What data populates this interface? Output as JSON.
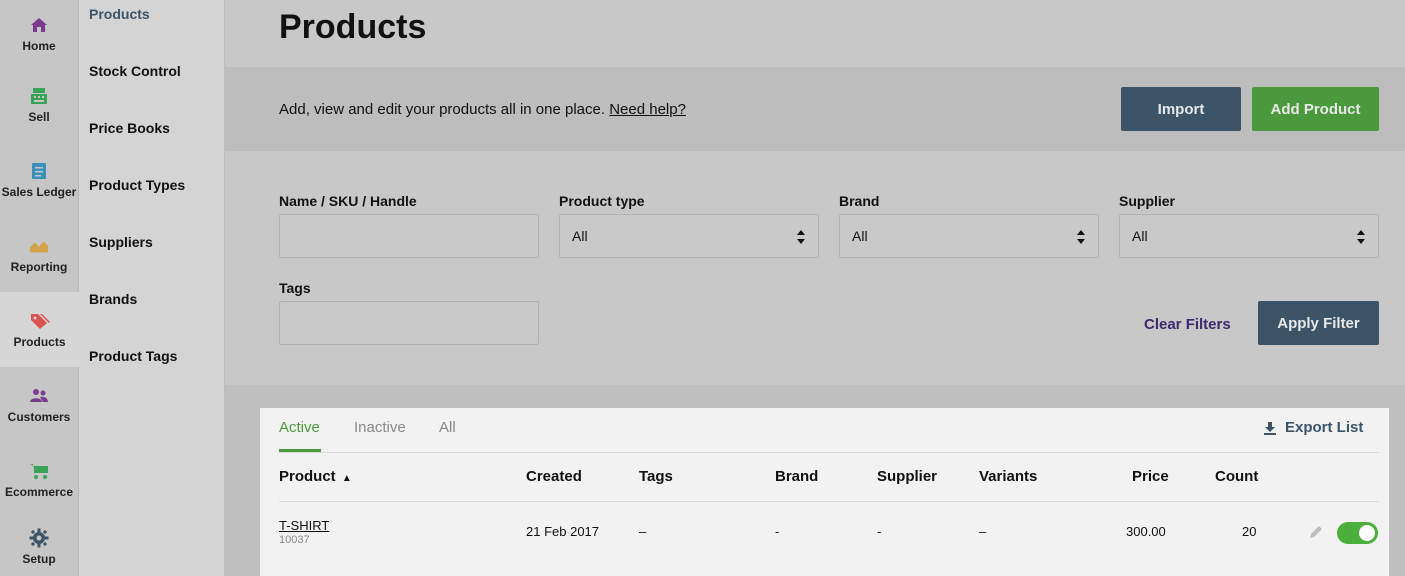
{
  "nav": {
    "items": [
      {
        "label": "Home",
        "icon": "home-icon",
        "color": "#7a3b8f"
      },
      {
        "label": "Sell",
        "icon": "register-icon",
        "color": "#3aa35a"
      },
      {
        "label": "Sales Ledger",
        "icon": "ledger-icon",
        "color": "#3a90b8"
      },
      {
        "label": "Reporting",
        "icon": "chart-icon",
        "color": "#d4a24a"
      },
      {
        "label": "Products",
        "icon": "tag-icon",
        "color": "#d9534f"
      },
      {
        "label": "Customers",
        "icon": "people-icon",
        "color": "#7a3b8f"
      },
      {
        "label": "Ecommerce",
        "icon": "cart-icon",
        "color": "#3aa35a"
      },
      {
        "label": "Setup",
        "icon": "gear-icon",
        "color": "#3b5468"
      }
    ]
  },
  "submenu": {
    "items": [
      "Products",
      "Stock Control",
      "Price Books",
      "Product Types",
      "Suppliers",
      "Brands",
      "Product Tags"
    ]
  },
  "page": {
    "title": "Products",
    "intro": "Add, view and edit your products all in one place.",
    "help_link": "Need help?",
    "import_label": "Import",
    "add_label": "Add Product"
  },
  "filters": {
    "name_label": "Name / SKU / Handle",
    "name_value": "",
    "type_label": "Product type",
    "type_value": "All",
    "brand_label": "Brand",
    "brand_value": "All",
    "supplier_label": "Supplier",
    "supplier_value": "All",
    "tags_label": "Tags",
    "tags_value": "",
    "clear_label": "Clear Filters",
    "apply_label": "Apply Filter"
  },
  "list": {
    "tabs": [
      "Active",
      "Inactive",
      "All"
    ],
    "export_label": "Export List",
    "columns": [
      "Product",
      "Created",
      "Tags",
      "Brand",
      "Supplier",
      "Variants",
      "Price",
      "Count"
    ],
    "sort_indicator": "▲",
    "rows": [
      {
        "name": "T-SHIRT",
        "sku": "10037",
        "created": "21 Feb 2017",
        "tags": "–",
        "brand": "-",
        "supplier": "-",
        "variants": "–",
        "price": "300.00",
        "count": "20",
        "active": true
      }
    ]
  },
  "colors": {
    "primary": "#3b5468",
    "success": "#4a9a3d",
    "link_dark": "#3d2a6d"
  }
}
